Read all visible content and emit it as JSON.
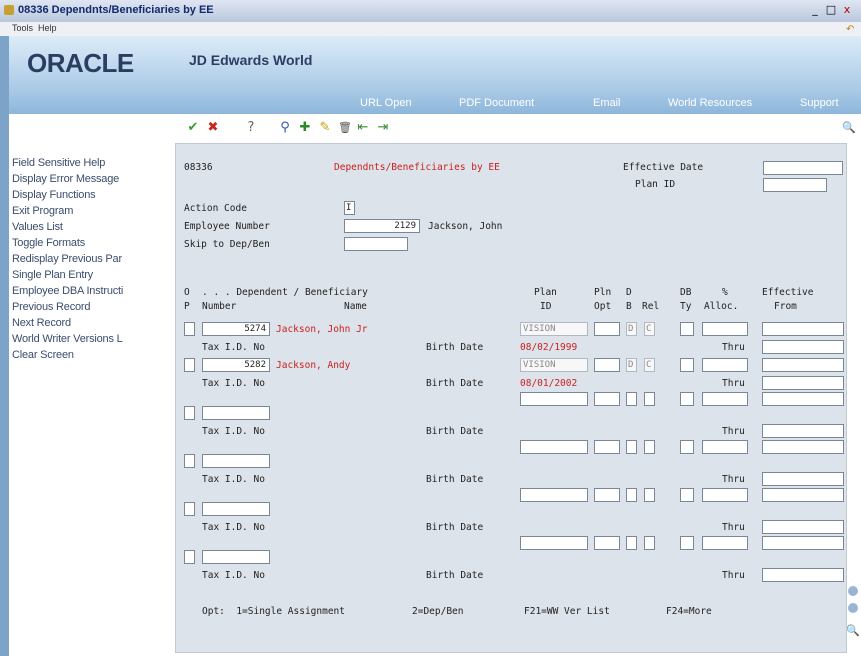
{
  "window": {
    "title": "08336  Dependnts/Beneficiaries by EE",
    "min": "_",
    "max": "□",
    "close": "x"
  },
  "menubar": {
    "items": [
      "Tools",
      "Help"
    ]
  },
  "header": {
    "logo": "ORACLE",
    "product": "JD Edwards World",
    "links": [
      "URL Open",
      "PDF Document",
      "Email",
      "World Resources",
      "Support"
    ]
  },
  "toolbar": {
    "ok": "✔",
    "cancel": "✖",
    "help": "?",
    "inquire": "⚲",
    "add": "✚",
    "change": "✎",
    "delete": "🗑",
    "prev": "⇤",
    "next": "⇥",
    "search": "🔍"
  },
  "exits": [
    "Field Sensitive Help",
    "Display Error Message",
    "Display Functions",
    "Exit Program",
    "Values List",
    "Toggle Formats",
    "Redisplay Previous Par",
    "Single Plan Entry",
    "Employee DBA Instructi",
    "Previous Record",
    "Next Record",
    "World Writer Versions L",
    "Clear Screen"
  ],
  "form": {
    "program": "08336",
    "heading": "Dependnts/Beneficiaries by EE",
    "effective_date_label": "Effective Date",
    "plan_id_label": "Plan ID",
    "action_code_label": "Action Code",
    "action_code": "I",
    "employee_number_label": "Employee Number",
    "employee_number": "2129",
    "employee_name": "Jackson, John",
    "skip_label": "Skip to Dep/Ben",
    "col_headers": {
      "o": "O",
      "p": "P",
      "dep_title": ". . . Dependent / Beneficiary",
      "number": "Number",
      "name": "Name",
      "plan1": "Plan",
      "plan2": "ID",
      "pln1": "Pln",
      "pln2": "Opt",
      "d1": "D",
      "d2": "B",
      "rel": "Rel",
      "db1": "DB",
      "db2": "Ty",
      "pct1": "%",
      "pct2": "Alloc.",
      "eff1": "Effective",
      "eff2": "From"
    },
    "tax_label": "Tax I.D. No",
    "birth_label": "Birth Date",
    "thru_label": "Thru",
    "rows": [
      {
        "number": "5274",
        "name": "Jackson, John Jr",
        "plan": "VISION",
        "db": "D",
        "rel": "C",
        "birth": "08/02/1999"
      },
      {
        "number": "5282",
        "name": "Jackson, Andy",
        "plan": "VISION",
        "db": "D",
        "rel": "C",
        "birth": "08/01/2002"
      },
      {
        "number": "",
        "name": "",
        "plan": "",
        "db": "",
        "rel": "",
        "birth": ""
      },
      {
        "number": "",
        "name": "",
        "plan": "",
        "db": "",
        "rel": "",
        "birth": ""
      },
      {
        "number": "",
        "name": "",
        "plan": "",
        "db": "",
        "rel": "",
        "birth": ""
      },
      {
        "number": "",
        "name": "",
        "plan": "",
        "db": "",
        "rel": "",
        "birth": ""
      }
    ],
    "footer": {
      "opt": "Opt:  1=Single Assignment",
      "depben": "2=Dep/Ben",
      "f21": "F21=WW Ver List",
      "f24": "F24=More"
    }
  }
}
